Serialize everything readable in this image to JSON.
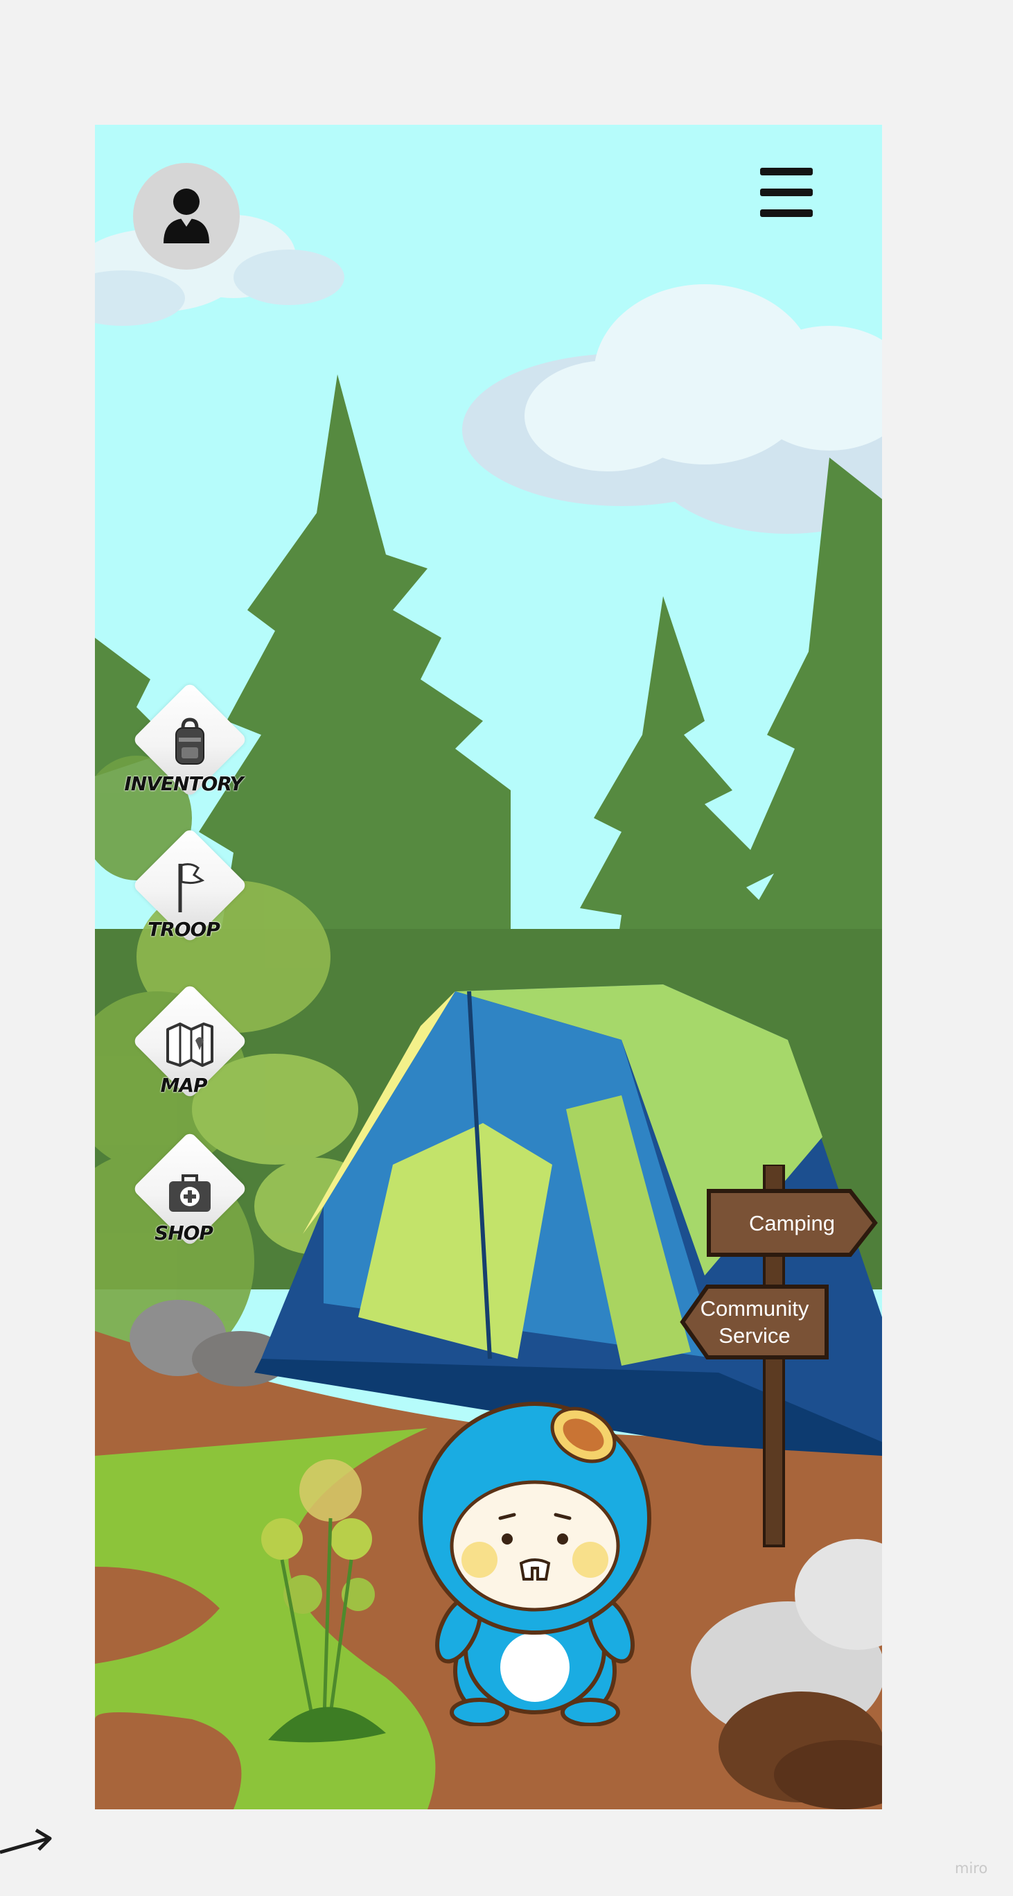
{
  "profile": {
    "icon": "user-icon"
  },
  "menu": {
    "icon": "hamburger-menu-icon"
  },
  "side_menu": [
    {
      "label": "INVENTORY",
      "icon": "backpack-icon"
    },
    {
      "label": "TROOP",
      "icon": "flag-icon"
    },
    {
      "label": "MAP",
      "icon": "map-icon"
    },
    {
      "label": "SHOP",
      "icon": "first-aid-kit-icon"
    }
  ],
  "signpost": {
    "camping": "Camping",
    "community_line1": "Community",
    "community_line2": "Service"
  },
  "watermark": "miro",
  "colors": {
    "sky": "#b6fcfb",
    "tree": "#568a40",
    "path": "#a8653b",
    "grass": "#8cc43a",
    "mascot": "#1aace2",
    "sign": "#7a5236"
  }
}
